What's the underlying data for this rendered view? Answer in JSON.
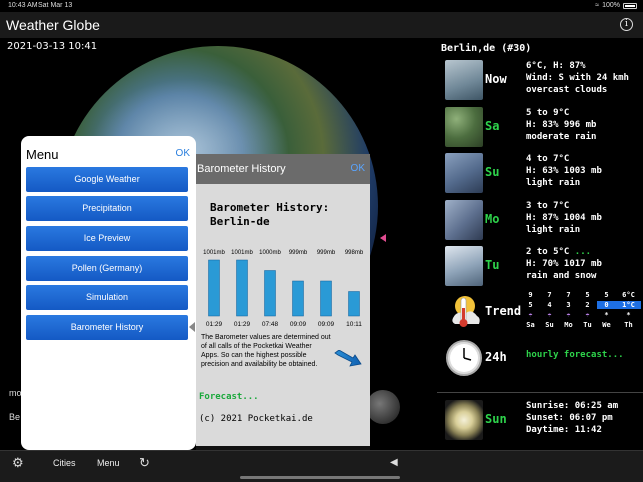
{
  "status_bar": {
    "time": "10:43 AM",
    "date": "Sat Mar 13",
    "battery": "100%"
  },
  "app": {
    "title": "Weather Globe",
    "info_icon": "info-icon"
  },
  "globe": {
    "datetime": "2021-03-13 10:41",
    "side_text_1": "mo",
    "side_text_2": "Be"
  },
  "menu": {
    "title": "Menu",
    "ok": "OK",
    "items": [
      "Google Weather",
      "Precipitation",
      "Ice Preview",
      "Pollen (Germany)",
      "Simulation",
      "Barometer History"
    ]
  },
  "barometer": {
    "title": "Barometer History",
    "ok": "OK",
    "heading": "Barometer History: Berlin-de",
    "description": "The Barometer values are determined out of all calls of the Pocketkai Weather Apps. So can the highest possible precision and availability be obtained.",
    "forecast": "Forecast...",
    "copyright": "(c) 2021 Pocketkai.de",
    "bar_color": "#2a9ad6"
  },
  "chart_data": {
    "type": "bar",
    "categories": [
      "01:29",
      "01:29",
      "07:48",
      "09:09",
      "09:09",
      "10:11"
    ],
    "values": [
      1001,
      1001,
      1000,
      999,
      999,
      998
    ],
    "value_labels": [
      "1001mb",
      "1001mb",
      "1000mb",
      "999mb",
      "999mb",
      "998mb"
    ],
    "title": "",
    "xlabel": "",
    "ylabel": ""
  },
  "forecast_panel": {
    "header": "Berlin,de (#30)",
    "rows": [
      {
        "day": "Now",
        "green": false,
        "lines": [
          "6°C, H: 87%",
          "Wind: S with 24 kmh",
          "overcast clouds"
        ]
      },
      {
        "day": "Sa",
        "green": true,
        "lines": [
          "5 to 9°C",
          "H: 83% 996 mb",
          "moderate rain"
        ]
      },
      {
        "day": "Su",
        "green": true,
        "lines": [
          "4 to 7°C",
          "H: 63% 1003 mb",
          "light rain"
        ]
      },
      {
        "day": "Mo",
        "green": true,
        "lines": [
          "3 to 7°C",
          "H: 87% 1004 mb",
          "light rain"
        ]
      },
      {
        "day": "Tu",
        "green": true,
        "lines": [
          "2 to 5°C",
          "H: 70% 1017 mb",
          "rain and snow"
        ],
        "more": "..."
      }
    ],
    "trend": {
      "label": "Trend",
      "highs": [
        "9",
        "7",
        "7",
        "5",
        "5",
        "6°C"
      ],
      "lows": [
        "5",
        "4",
        "3",
        "2",
        "0",
        "1°C"
      ],
      "days": [
        "Sa",
        "Su",
        "Mo",
        "Tu",
        "We",
        "Th"
      ]
    },
    "hourly": {
      "label": "24h",
      "text": "hourly forecast..."
    },
    "sun": {
      "label": "Sun",
      "sunrise": "Sunrise: 06:25 am",
      "sunset": "Sunset: 06:07 pm",
      "daytime": "Daytime: 11:42"
    }
  },
  "toolbar": {
    "cities": "Cities",
    "menu": "Menu"
  }
}
